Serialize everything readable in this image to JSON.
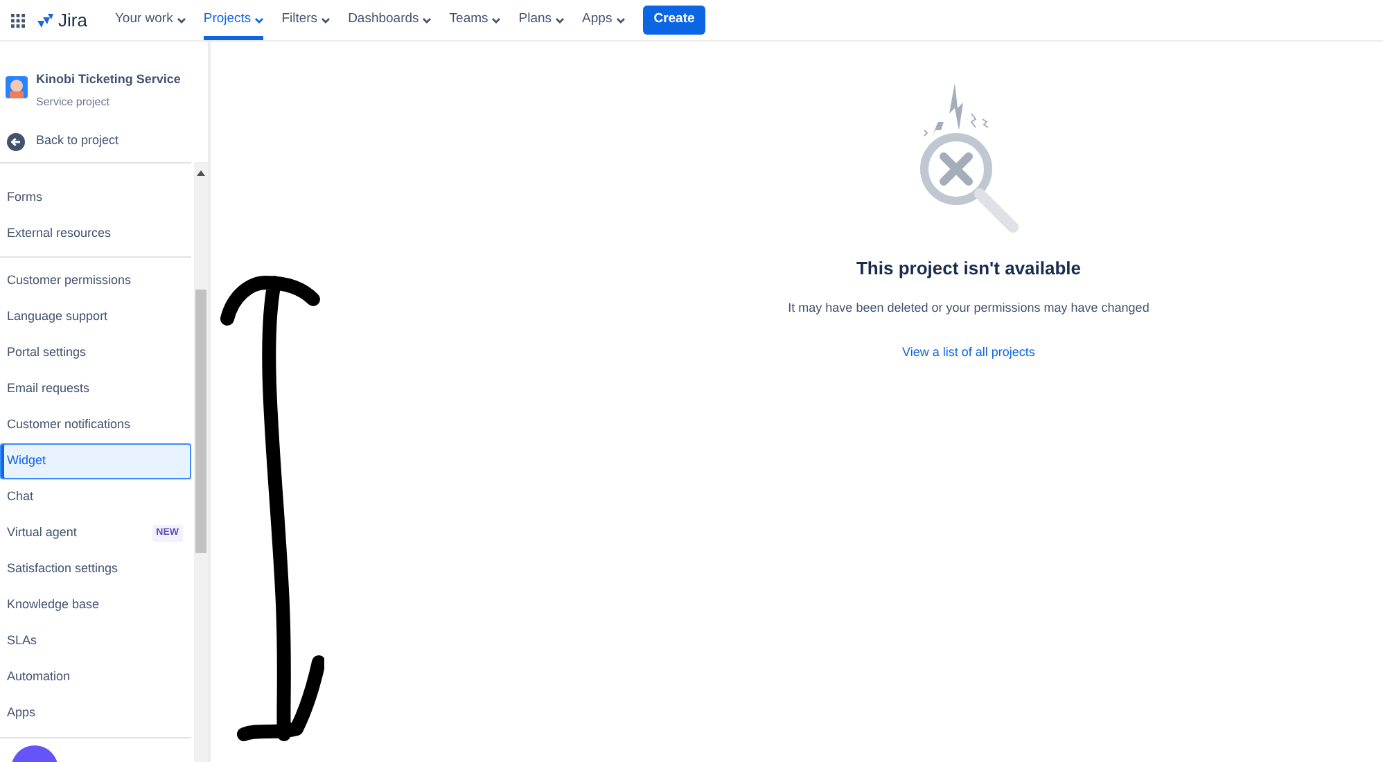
{
  "app": {
    "name": "Jira"
  },
  "nav": [
    {
      "label": "Your work",
      "selected": false
    },
    {
      "label": "Projects",
      "selected": true
    },
    {
      "label": "Filters",
      "selected": false
    },
    {
      "label": "Dashboards",
      "selected": false
    },
    {
      "label": "Teams",
      "selected": false
    },
    {
      "label": "Plans",
      "selected": false
    },
    {
      "label": "Apps",
      "selected": false
    }
  ],
  "create_button": "Create",
  "project": {
    "name": "Kinobi Ticketing Service",
    "type": "Service project"
  },
  "back_link": "Back to project",
  "sidebar_groups": [
    {
      "items": [
        {
          "label": "Forms",
          "selected": false
        },
        {
          "label": "External resources",
          "selected": false
        }
      ]
    },
    {
      "items": [
        {
          "label": "Customer permissions",
          "selected": false
        },
        {
          "label": "Language support",
          "selected": false
        },
        {
          "label": "Portal settings",
          "selected": false
        },
        {
          "label": "Email requests",
          "selected": false
        },
        {
          "label": "Customer notifications",
          "selected": false
        },
        {
          "label": "Widget",
          "selected": true
        },
        {
          "label": "Chat",
          "selected": false
        },
        {
          "label": "Virtual agent",
          "selected": false,
          "badge": "NEW"
        },
        {
          "label": "Satisfaction settings",
          "selected": false
        },
        {
          "label": "Knowledge base",
          "selected": false
        },
        {
          "label": "SLAs",
          "selected": false
        },
        {
          "label": "Automation",
          "selected": false
        },
        {
          "label": "Apps",
          "selected": false
        }
      ]
    }
  ],
  "message": {
    "title": "This project isn't available",
    "body": "It may have been deleted or your permissions may have changed",
    "link": "View a list of all projects"
  }
}
